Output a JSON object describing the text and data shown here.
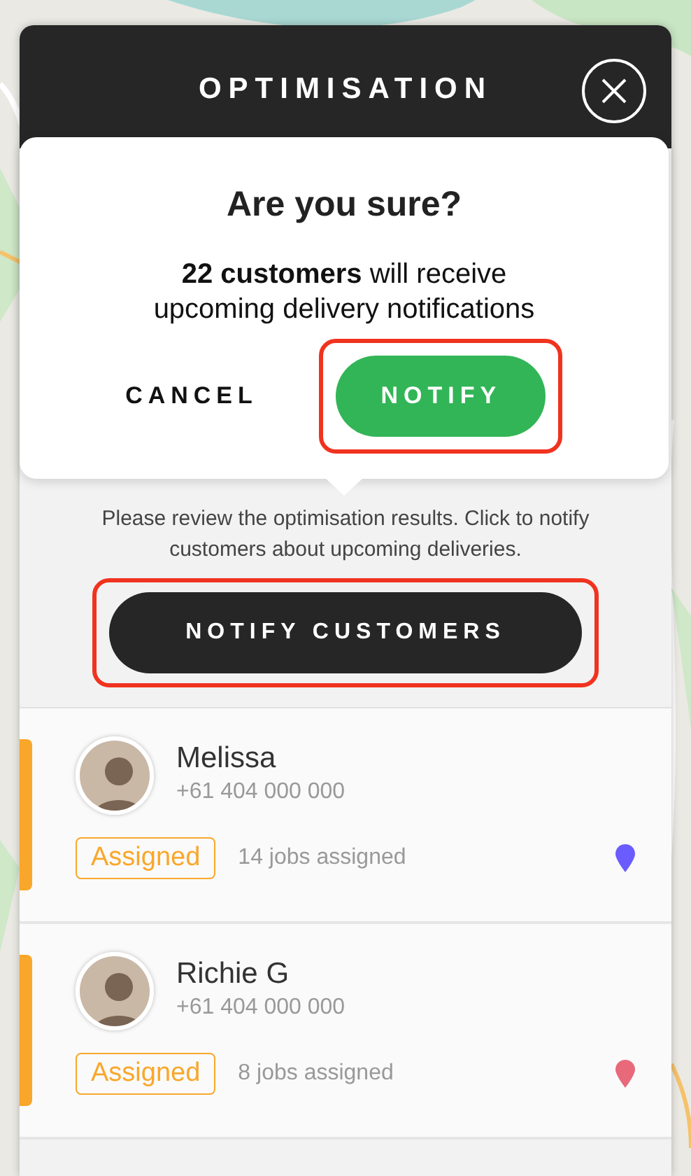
{
  "panel": {
    "title": "OPTIMISATION"
  },
  "confirm": {
    "title": "Are you sure?",
    "message": "**22 customers** will receive upcoming delivery notifications",
    "cancel": "CANCEL",
    "notify": "NOTIFY",
    "notify_highlighted": true
  },
  "review": {
    "text": "Please review the optimisation results. Click to notify customers about upcoming deliveries.",
    "button": "NOTIFY CUSTOMERS",
    "button_highlighted": true
  },
  "drivers": [
    {
      "name": "Melissa",
      "phone": "+61 404 000 000",
      "status": "Assigned",
      "jobs": "14 jobs assigned",
      "color": "#6b5cff"
    },
    {
      "name": "Richie G",
      "phone": "+61 404 000 000",
      "status": "Assigned",
      "jobs": "8 jobs assigned",
      "color": "#e8697a"
    }
  ]
}
